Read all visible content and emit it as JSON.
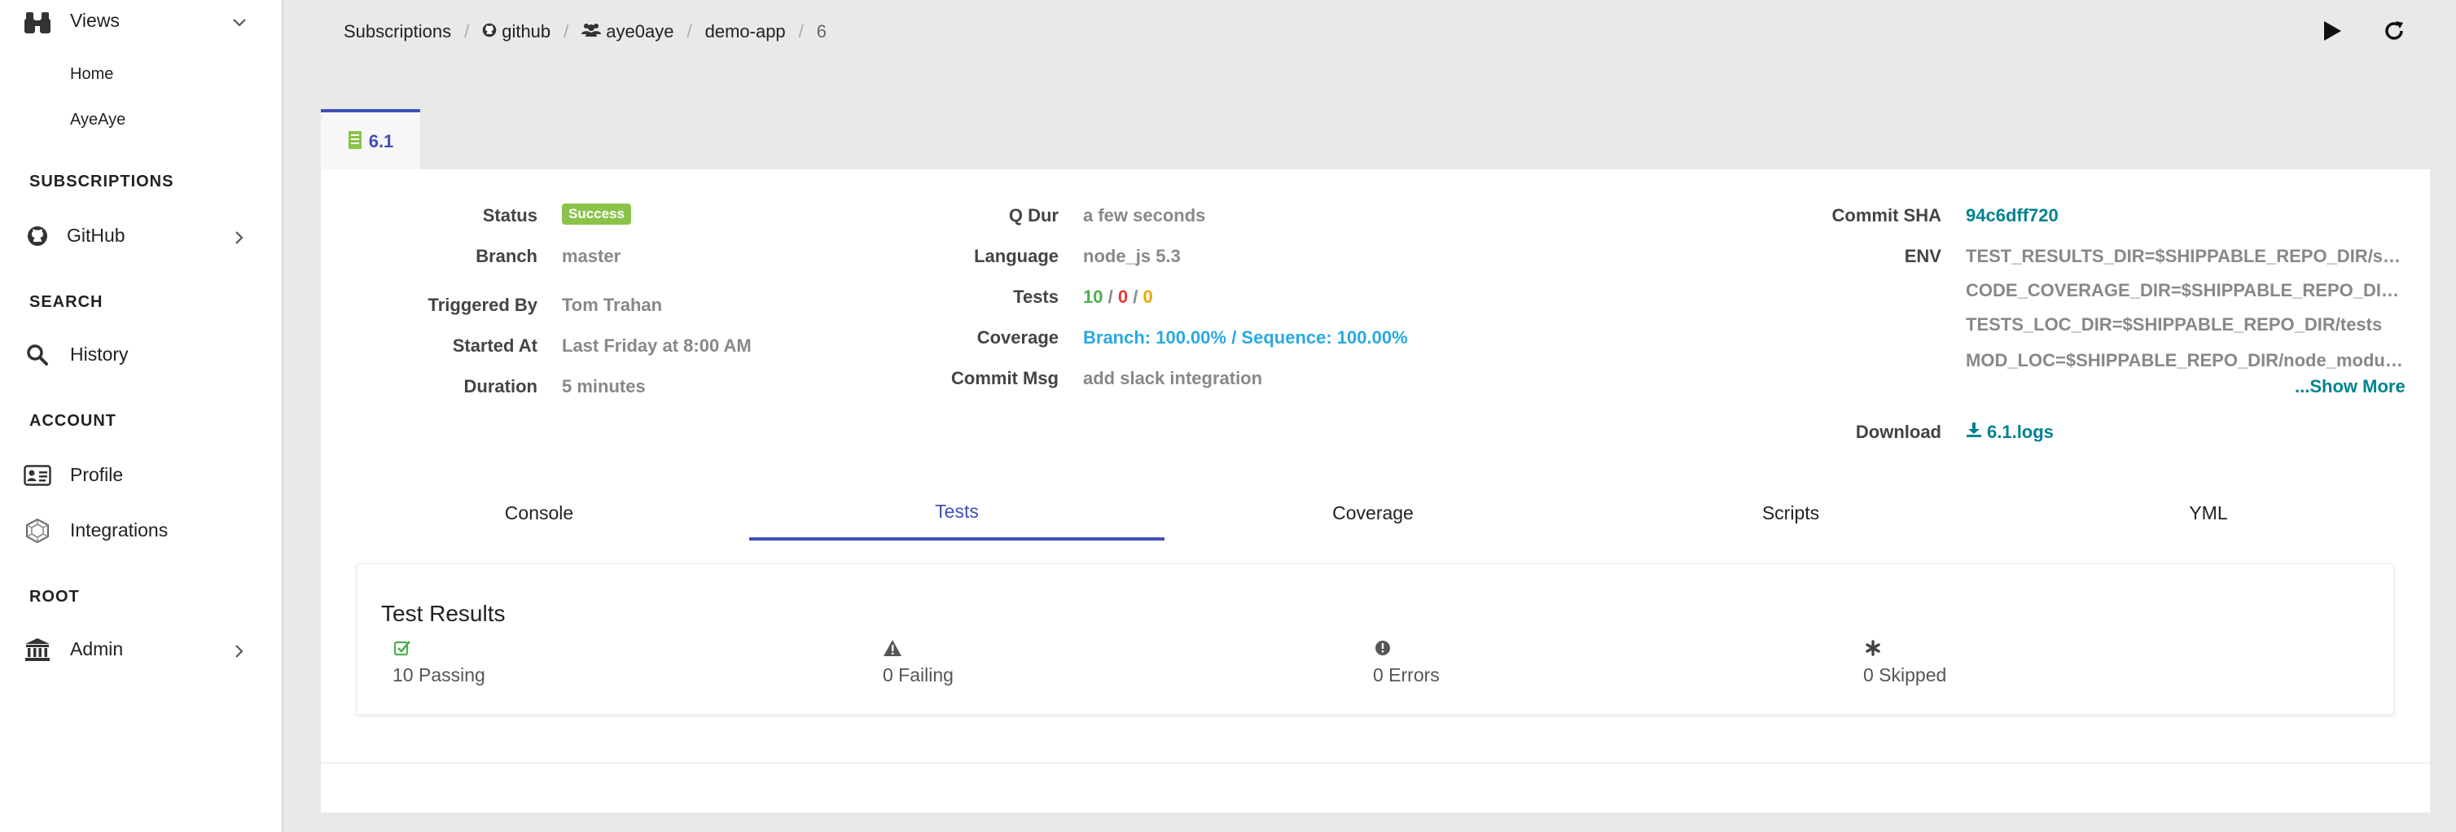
{
  "sidebar": {
    "views": {
      "label": "Views",
      "icon": "binoculars-icon"
    },
    "views_items": [
      "Home",
      "AyeAye"
    ],
    "subscriptions_heading": "SUBSCRIPTIONS",
    "github": {
      "label": "GitHub",
      "icon": "github-icon"
    },
    "search_heading": "SEARCH",
    "history": {
      "label": "History",
      "icon": "search-icon"
    },
    "account_heading": "ACCOUNT",
    "profile": {
      "label": "Profile",
      "icon": "id-card-icon"
    },
    "integrations": {
      "label": "Integrations",
      "icon": "hexagon-icon"
    },
    "root_heading": "ROOT",
    "admin": {
      "label": "Admin",
      "icon": "bank-icon"
    }
  },
  "breadcrumb": {
    "subscriptions": "Subscriptions",
    "github": "github",
    "org": "aye0aye",
    "repo": "demo-app",
    "run": "6"
  },
  "build_tab": {
    "label": "6.1",
    "icon": "document-icon"
  },
  "details": {
    "status_label": "Status",
    "status_value": "Success",
    "branch_label": "Branch",
    "branch_value": "master",
    "triggered_label": "Triggered By",
    "triggered_value": "Tom Trahan",
    "started_label": "Started At",
    "started_value": "Last Friday at 8:00 AM",
    "duration_label": "Duration",
    "duration_value": "5 minutes",
    "qdur_label": "Q Dur",
    "qdur_value": "a few seconds",
    "language_label": "Language",
    "language_value": "node_js 5.3",
    "tests_label": "Tests",
    "tests_pass": "10",
    "tests_fail": "0",
    "tests_skip": "0",
    "coverage_label": "Coverage",
    "coverage_value": "Branch: 100.00% / Sequence: 100.00%",
    "commitmsg_label": "Commit Msg",
    "commitmsg_value": "add slack integration",
    "sha_label": "Commit SHA",
    "sha_value": "94c6dff720",
    "env_label": "ENV",
    "env_values": [
      "TEST_RESULTS_DIR=$SHIPPABLE_REPO_DIR/shippable/testresults",
      "CODE_COVERAGE_DIR=$SHIPPABLE_REPO_DIR/shippable/codecoverage",
      "TESTS_LOC_DIR=$SHIPPABLE_REPO_DIR/tests",
      "MOD_LOC=$SHIPPABLE_REPO_DIR/node_modules/.bin"
    ],
    "show_more": "...Show More",
    "download_label": "Download",
    "download_value": "6.1.logs"
  },
  "content_tabs": [
    "Console",
    "Tests",
    "Coverage",
    "Scripts",
    "YML"
  ],
  "active_tab": "Tests",
  "test_results": {
    "title": "Test Results",
    "passing": "10 Passing",
    "failing": "0 Failing",
    "errors": "0 Errors",
    "skipped": "0 Skipped"
  },
  "colors": {
    "accent": "#3f51b5",
    "success": "#8bc34a",
    "link_teal": "#00838f",
    "coverage_blue": "#29a9e0"
  }
}
